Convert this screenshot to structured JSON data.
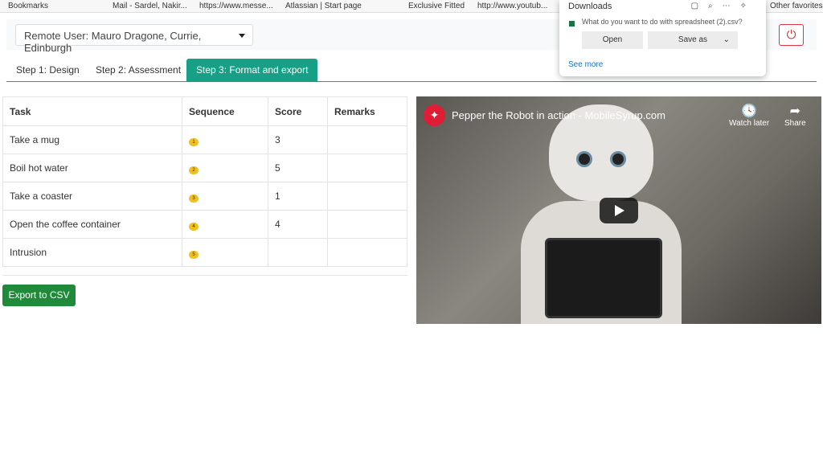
{
  "bookmarks": [
    "Bookmarks",
    "Mail - Sardel, Nakir...",
    "https://www.messe...",
    "Atlassian | Start page",
    "Exclusive Fitted",
    "http://www.youtub...",
    "Other favorites"
  ],
  "remote_user": "Remote User: Mauro Dragone, Currie, Edinburgh",
  "tabs": [
    "Step 1: Design",
    "Step 2: Assessment",
    "Step 3: Format and export"
  ],
  "table": {
    "headers": [
      "Task",
      "Sequence",
      "Score",
      "Remarks"
    ],
    "rows": [
      {
        "task": "Take a mug",
        "seq": "1",
        "score": "3",
        "remarks": ""
      },
      {
        "task": "Boil hot water",
        "seq": "2",
        "score": "5",
        "remarks": ""
      },
      {
        "task": "Take a coaster",
        "seq": "3",
        "score": "1",
        "remarks": ""
      },
      {
        "task": "Open the coffee container",
        "seq": "4",
        "score": "4",
        "remarks": ""
      },
      {
        "task": "Intrusion",
        "seq": "5",
        "score": "",
        "remarks": ""
      }
    ]
  },
  "export_label": "Export to CSV",
  "video": {
    "title": "Pepper the Robot in action - MobileSyrup.com",
    "watch_later": "Watch later",
    "share": "Share"
  },
  "downloads": {
    "title": "Downloads",
    "question": "What do you want to do with spreadsheet (2).csv?",
    "open": "Open",
    "save_as": "Save as",
    "see_more": "See more"
  },
  "colors": {
    "accent": "#17a085",
    "export": "#1e8a3a",
    "power": "#dc3545",
    "badge": "#f0c020"
  }
}
